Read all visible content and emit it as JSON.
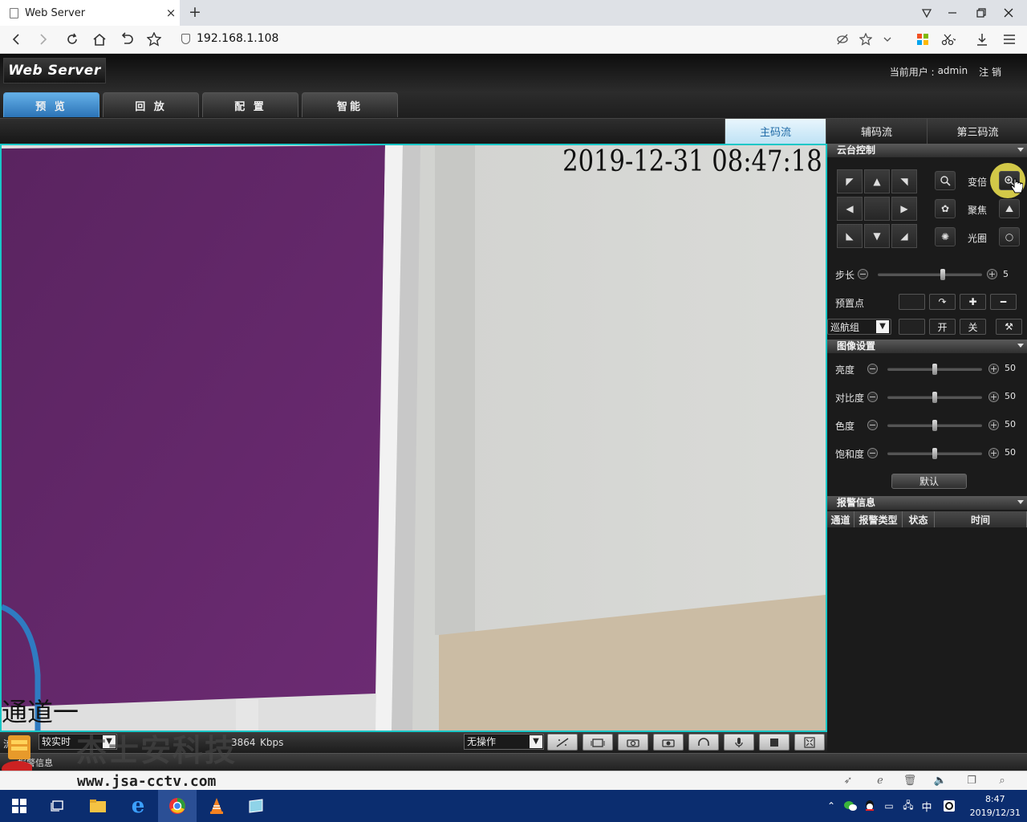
{
  "browser": {
    "tab_title": "Web Server",
    "tab_close": "×",
    "new_tab": "+",
    "url": "192.168.1.108"
  },
  "app": {
    "logo": "Web Server",
    "current_user_label": "当前用户 :",
    "current_user": "admin",
    "logout": "注 销",
    "main_tabs": [
      "预 览",
      "回 放",
      "配 置",
      "智能"
    ],
    "stream_tabs": [
      "主码流",
      "辅码流",
      "第三码流"
    ]
  },
  "video": {
    "osd_timestamp": "2019-12-31  08:47:18",
    "osd_channel": "通道一"
  },
  "video_bar": {
    "stream_label": "流",
    "mode_value": "较实时",
    "bitrate_value": "3864",
    "bitrate_unit": "Kbps",
    "action_value": "无操作"
  },
  "ptz": {
    "title": "云台控制",
    "zoom_label": "变倍",
    "focus_label": "聚焦",
    "iris_label": "光圈",
    "step_label": "步长",
    "step_value": 5,
    "step_max": 8,
    "step_display": "5",
    "preset_label": "预置点",
    "cruise_label": "巡航组",
    "cruise_on": "开",
    "cruise_off": "关"
  },
  "image_settings": {
    "title": "图像设置",
    "rows": [
      {
        "label": "亮度",
        "value": 50,
        "display": "50"
      },
      {
        "label": "对比度",
        "value": 50,
        "display": "50"
      },
      {
        "label": "色度",
        "value": 50,
        "display": "50"
      },
      {
        "label": "饱和度",
        "value": 50,
        "display": "50"
      }
    ],
    "default_button": "默认"
  },
  "alarm": {
    "title": "报警信息",
    "columns": [
      "通道",
      "报警类型",
      "状态",
      "时间"
    ],
    "bottom_label": "报警信息"
  },
  "overlay": {
    "watermark_url": "www.jsa-cctv.com",
    "watermark_brand": "杰士安科技"
  },
  "taskbar": {
    "time": "8:47",
    "date": "2019/12/31",
    "ime": "中"
  }
}
